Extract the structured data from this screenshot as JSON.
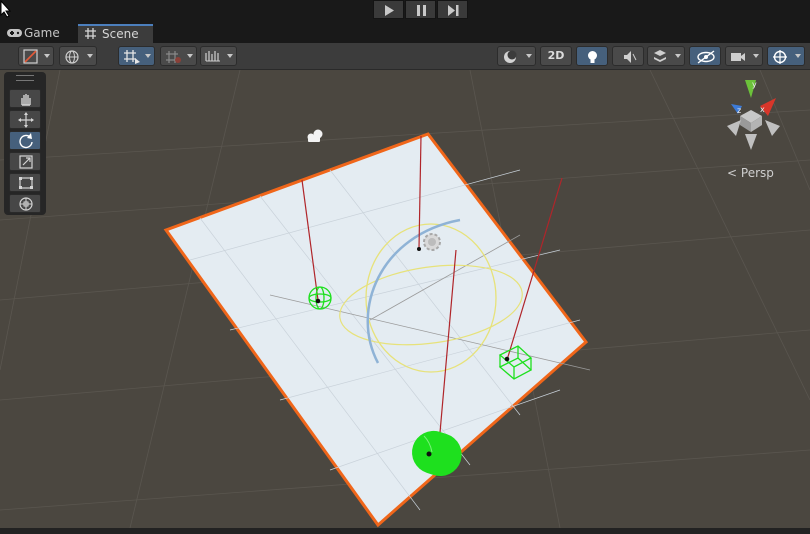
{
  "play_controls": {
    "play": "play-icon",
    "pause": "pause-icon",
    "step": "step-icon"
  },
  "tabs": [
    {
      "label": "Game",
      "icon": "gamepad-icon",
      "active": false
    },
    {
      "label": "Scene",
      "icon": "grid-hash-icon",
      "active": true
    }
  ],
  "toolbar": {
    "toggle_2d_label": "2D",
    "left_group": [
      "draw-mode-icon",
      "globe-icon",
      "grid-snap-icon",
      "increment-snap-icon",
      "ruler-icon"
    ],
    "right_group": [
      "shading-sphere-icon",
      "lightbulb-icon",
      "audio-mute-icon",
      "effects-icon",
      "hidden-eye-icon",
      "camera-icon",
      "gizmos-icon"
    ]
  },
  "tools": [
    "hand-tool",
    "move-tool",
    "rotate-tool",
    "scale-tool",
    "rect-tool",
    "transform-tool"
  ],
  "active_tool": "rotate-tool",
  "scene_gizmo": {
    "projection_label": "Persp"
  },
  "colors": {
    "accent": "#4c7fbd",
    "viewport": "#4b4740",
    "selection_outline": "#f0661a",
    "collider_green": "#1ee01e",
    "light_yellow": "#e7e27a",
    "gizmo_x": "#d8362a",
    "gizmo_y": "#6cc23a",
    "gizmo_z": "#3c7bd8"
  }
}
